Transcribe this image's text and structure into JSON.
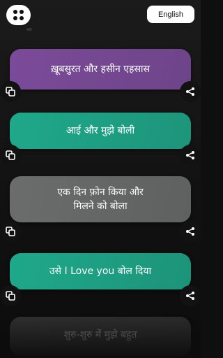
{
  "header": {
    "menu_icon": "grid-menu-icon",
    "language_label": "English"
  },
  "cards": [
    {
      "text": "ख़ूबसुरत और हसीन एहसास",
      "color": "#7b4b9a"
    },
    {
      "text": "आई और मुझे बोली",
      "color": "#1fa88a"
    },
    {
      "text": "एक दिन फ़ोन किया और\nमिलने को बोला",
      "color": "#6a6d6c"
    },
    {
      "text": "उसे I Love you बोल दिया",
      "color": "#1fa88a"
    },
    {
      "text": "शुरु-शुरु में मुझे बहुत",
      "color": "#5a5a5a"
    }
  ],
  "icons": {
    "copy": "copy-icon",
    "share": "share-icon"
  }
}
